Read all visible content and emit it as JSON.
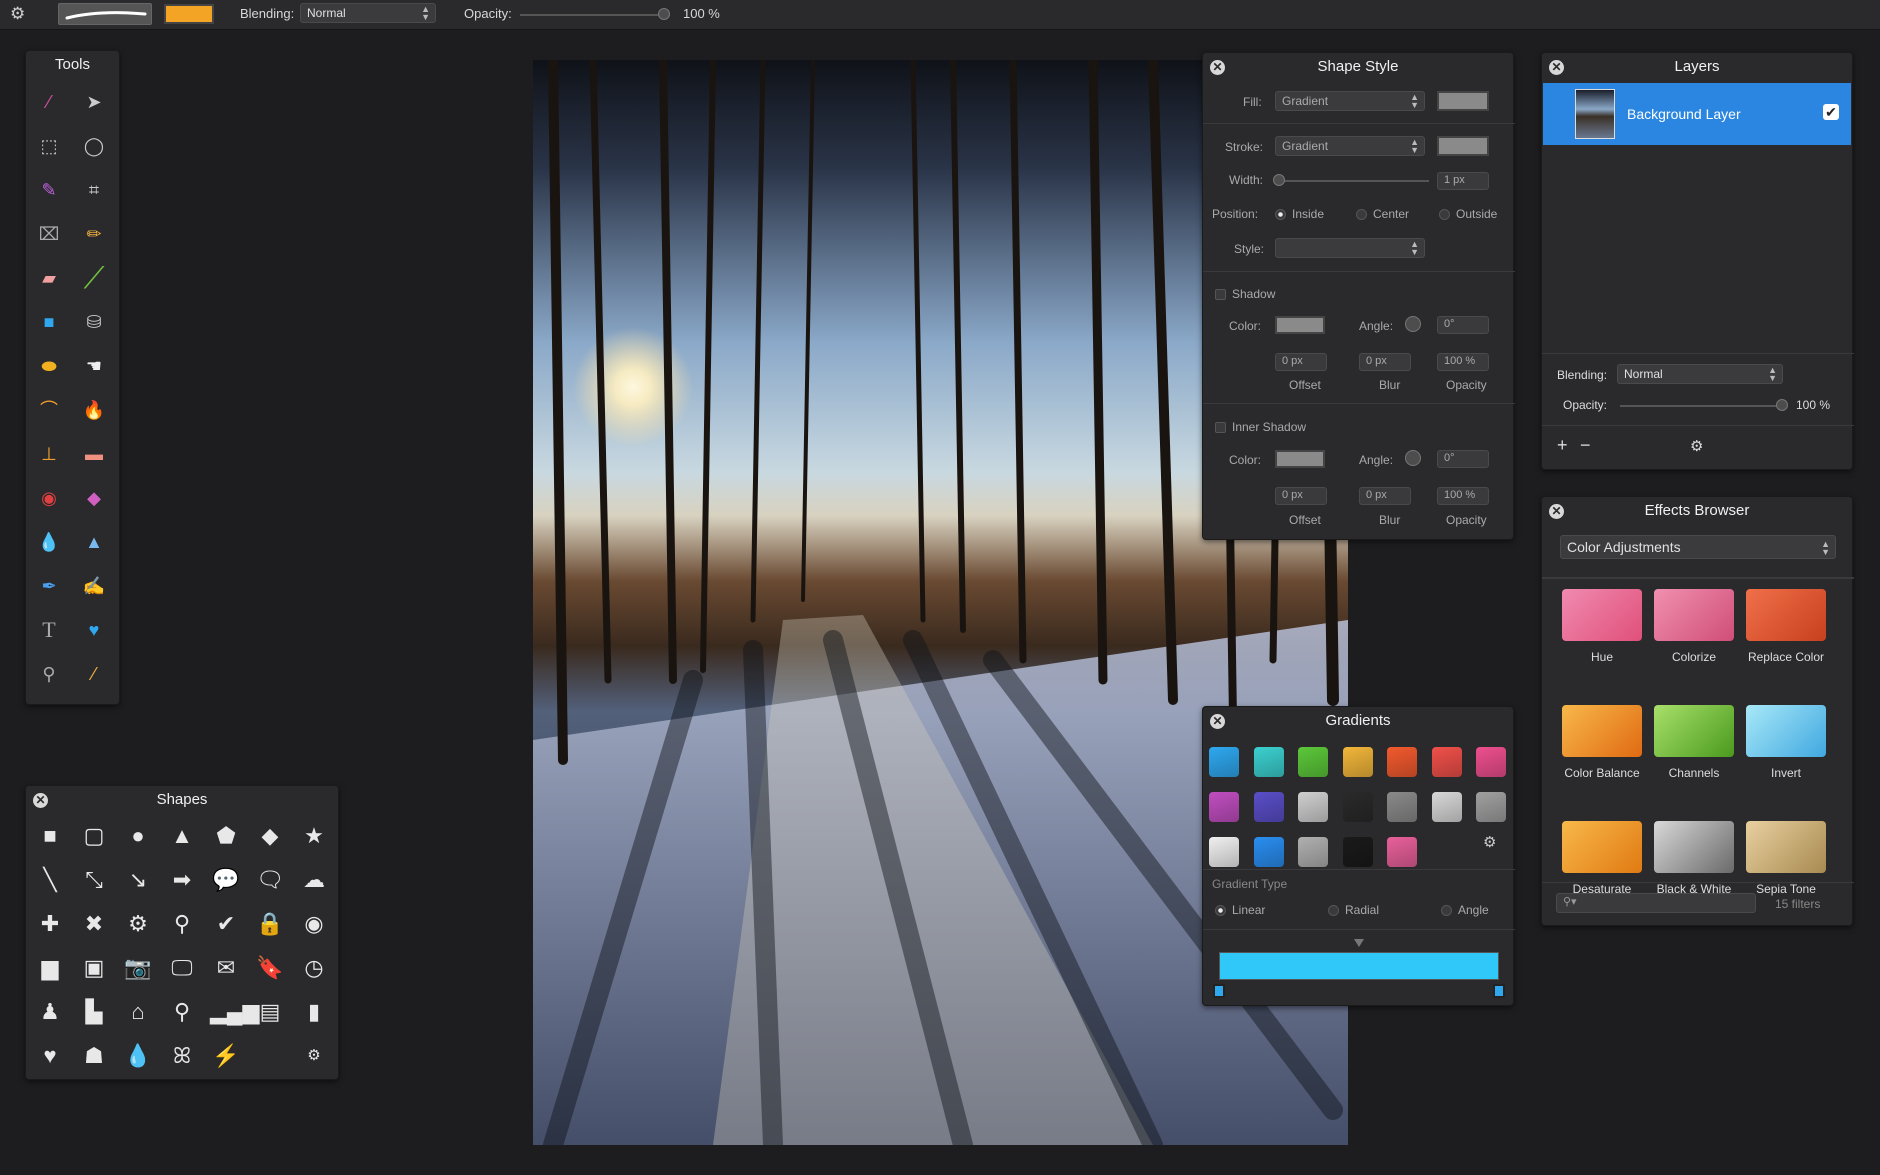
{
  "toolbar": {
    "blending_label": "Blending:",
    "blending_value": "Normal",
    "opacity_label": "Opacity:",
    "opacity_value": "100 %",
    "color": "#f4a425",
    "gear_icon": "gear-icon"
  },
  "tools": {
    "title": "Tools"
  },
  "shapes": {
    "title": "Shapes"
  },
  "shape_style": {
    "title": "Shape Style",
    "fill_label": "Fill:",
    "fill_value": "Gradient",
    "stroke_label": "Stroke:",
    "stroke_value": "Gradient",
    "width_label": "Width:",
    "width_value": "1 px",
    "position_label": "Position:",
    "position_inside": "Inside",
    "position_center": "Center",
    "position_outside": "Outside",
    "style_label": "Style:",
    "shadow_label": "Shadow",
    "color_label": "Color:",
    "angle_label": "Angle:",
    "angle_value": "0°",
    "offset_value": "0 px",
    "blur_value": "0 px",
    "opacity_value": "100 %",
    "offset_label": "Offset",
    "blur_label": "Blur",
    "opacity_label": "Opacity",
    "inner_shadow_label": "Inner Shadow"
  },
  "gradients": {
    "title": "Gradients",
    "type_label": "Gradient Type",
    "linear": "Linear",
    "radial": "Radial",
    "angle": "Angle",
    "swatches": [
      "#2fa8f0",
      "#3cd0d0",
      "#5cc83a",
      "#f2b63a",
      "#f25a2e",
      "#f0504a",
      "#ee4f8e",
      "#c04ec0",
      "#5a4ec8",
      "#cfcfcf",
      "#2a2a2a",
      "#8a8a8a",
      "#d8d8d8",
      "#a0a0a0",
      "#f0f0f0",
      "#2a8ef0",
      "#b0b0b0",
      "#1a1a1a",
      "#e8609a"
    ],
    "bar_color": "#2fc8f8"
  },
  "layers": {
    "title": "Layers",
    "layer_name": "Background Layer",
    "blending_label": "Blending:",
    "blending_value": "Normal",
    "opacity_label": "Opacity:",
    "opacity_value": "100 %",
    "add": "+",
    "remove": "−"
  },
  "effects": {
    "title": "Effects Browser",
    "category": "Color Adjustments",
    "filter_count": "15 filters",
    "items": [
      {
        "label": "Hue",
        "c1": "#f08ab0",
        "c2": "#e0507a"
      },
      {
        "label": "Colorize",
        "c1": "#f090b0",
        "c2": "#d04e78"
      },
      {
        "label": "Replace Color",
        "c1": "#f0704a",
        "c2": "#c8401e"
      },
      {
        "label": "Color Balance",
        "c1": "#f8b84a",
        "c2": "#e06a12"
      },
      {
        "label": "Channels",
        "c1": "#a8e06a",
        "c2": "#4a9a1e"
      },
      {
        "label": "Invert",
        "c1": "#a8e8f8",
        "c2": "#40a8e0"
      },
      {
        "label": "Desaturate",
        "c1": "#f8b84a",
        "c2": "#e07a12"
      },
      {
        "label": "Black & White",
        "c1": "#d8d8d8",
        "c2": "#6a6a6a"
      },
      {
        "label": "Sepia Tone",
        "c1": "#e8d0a0",
        "c2": "#a88a50"
      }
    ]
  }
}
